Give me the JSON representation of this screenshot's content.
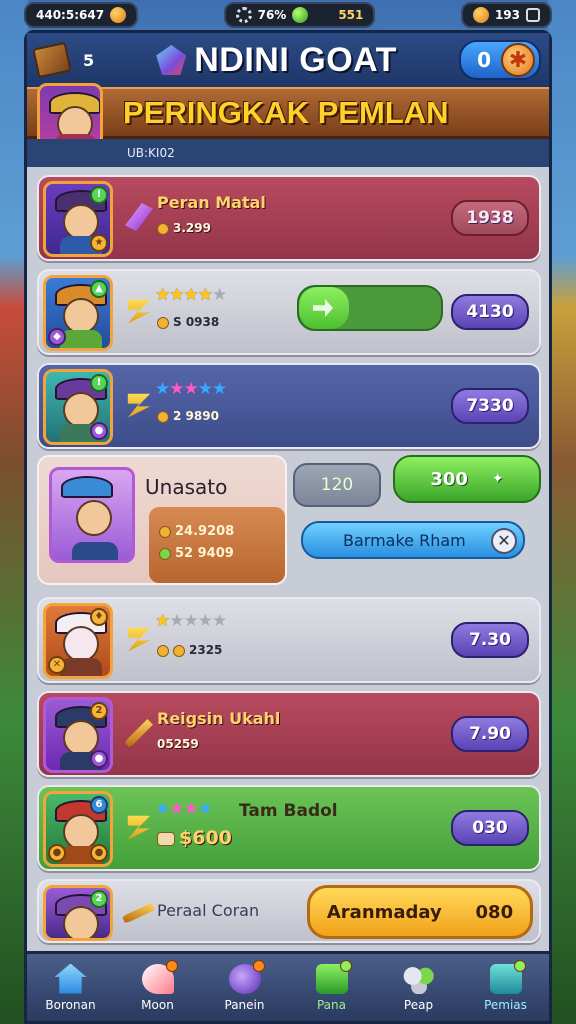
{
  "status_bar": {
    "time": "440:5:647",
    "percent": "76%",
    "resource": "551",
    "coins": "193"
  },
  "header": {
    "left_count": "5",
    "title": "NDINI GOAT",
    "counter_value": "0"
  },
  "banner": {
    "title": "PERINGKAK PEMLAN",
    "subtitle": "UB:KI02"
  },
  "rows": [
    {
      "name": "Peran Matal",
      "sub": "3.299",
      "score": "1938",
      "style": "maroon"
    },
    {
      "stars_on": 4,
      "stars_total": 5,
      "sub": "S 0938",
      "score": "4130",
      "style": "grey",
      "progress": 0.35
    },
    {
      "stars_colors": [
        "blue",
        "pink",
        "pink",
        "blue",
        "blue"
      ],
      "sub": "2 9890",
      "score": "7330",
      "style": "navy"
    },
    {
      "stars_on": 1,
      "stars_total": 5,
      "sub": "2325",
      "score": "7.30",
      "style": "grey"
    },
    {
      "name": "Reigsin Ukahl",
      "sub": "05259",
      "score": "7.90",
      "style": "maroon"
    },
    {
      "name": "Tam Badol",
      "sub": "$600",
      "score": "030",
      "style": "green"
    },
    {
      "name": "Peraal Coran",
      "button_label": "Aranmaday",
      "button_value": "080",
      "style": "grey"
    }
  ],
  "featured": {
    "name": "Unasato",
    "stat1": "24.9208",
    "stat2": "52 9409",
    "small_value": "120",
    "green_value": "300",
    "blue_button": "Barmake Rham"
  },
  "tabs": [
    {
      "label": "Boronan",
      "icon": "house-icon"
    },
    {
      "label": "Moon",
      "icon": "shuttlecock-icon"
    },
    {
      "label": "Panein",
      "icon": "orb-icon"
    },
    {
      "label": "Pana",
      "icon": "chat-icon"
    },
    {
      "label": "Peap",
      "icon": "group-icon"
    },
    {
      "label": "Pemias",
      "icon": "trophy-icon"
    }
  ],
  "colors": {
    "accent_gold": "#ffd12a",
    "maroon": "#b84a5e",
    "navy": "#5566a8",
    "green": "#6cc456"
  }
}
